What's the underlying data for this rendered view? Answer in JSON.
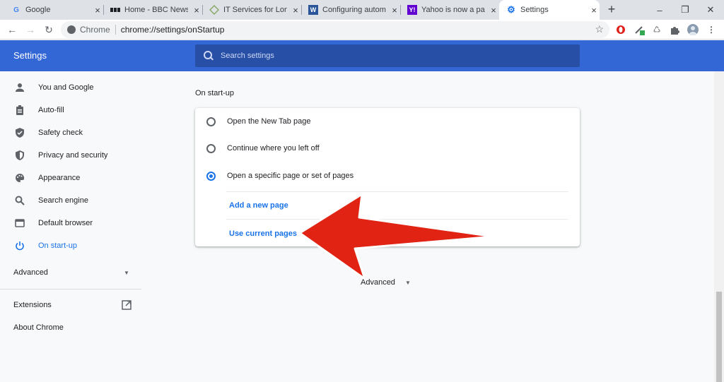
{
  "tabs": [
    {
      "title": "Google",
      "favicon": "google-favicon",
      "active": false
    },
    {
      "title": "Home - BBC News",
      "favicon": "bbc-favicon",
      "active": false
    },
    {
      "title": "IT Services for London",
      "favicon": "diamond-favicon",
      "active": false
    },
    {
      "title": "Configuring automatic",
      "favicon": "word-favicon",
      "active": false
    },
    {
      "title": "Yahoo is now a part of",
      "favicon": "yahoo-favicon",
      "active": false
    },
    {
      "title": "Settings",
      "favicon": "gear-icon",
      "active": true
    }
  ],
  "tab_close": "×",
  "new_tab": "+",
  "window_controls": {
    "minimize": "–",
    "restore": "❐",
    "close": "✕"
  },
  "omnibox": {
    "chip": "Chrome",
    "url": "chrome://settings/onStartup"
  },
  "header": {
    "app_name": "Settings",
    "search_placeholder": "Search settings"
  },
  "sidebar": {
    "items": [
      {
        "label": "You and Google",
        "icon": "person-icon",
        "selected": false
      },
      {
        "label": "Auto-fill",
        "icon": "clipboard-icon",
        "selected": false
      },
      {
        "label": "Safety check",
        "icon": "shield-check-icon",
        "selected": false
      },
      {
        "label": "Privacy and security",
        "icon": "shield-icon",
        "selected": false
      },
      {
        "label": "Appearance",
        "icon": "palette-icon",
        "selected": false
      },
      {
        "label": "Search engine",
        "icon": "search-icon",
        "selected": false
      },
      {
        "label": "Default browser",
        "icon": "browser-icon",
        "selected": false
      },
      {
        "label": "On start-up",
        "icon": "power-icon",
        "selected": true
      }
    ],
    "advanced_label": "Advanced",
    "extensions_label": "Extensions",
    "about_label": "About Chrome"
  },
  "main": {
    "section_title": "On start-up",
    "options": [
      {
        "label": "Open the New Tab page",
        "checked": false
      },
      {
        "label": "Continue where you left off",
        "checked": false
      },
      {
        "label": "Open a specific page or set of pages",
        "checked": true
      }
    ],
    "add_page_label": "Add a new page",
    "use_current_label": "Use current pages",
    "advanced_label": "Advanced"
  },
  "colors": {
    "accent": "#1a73e8",
    "header": "#3367d6",
    "arrow": "#e02312"
  }
}
